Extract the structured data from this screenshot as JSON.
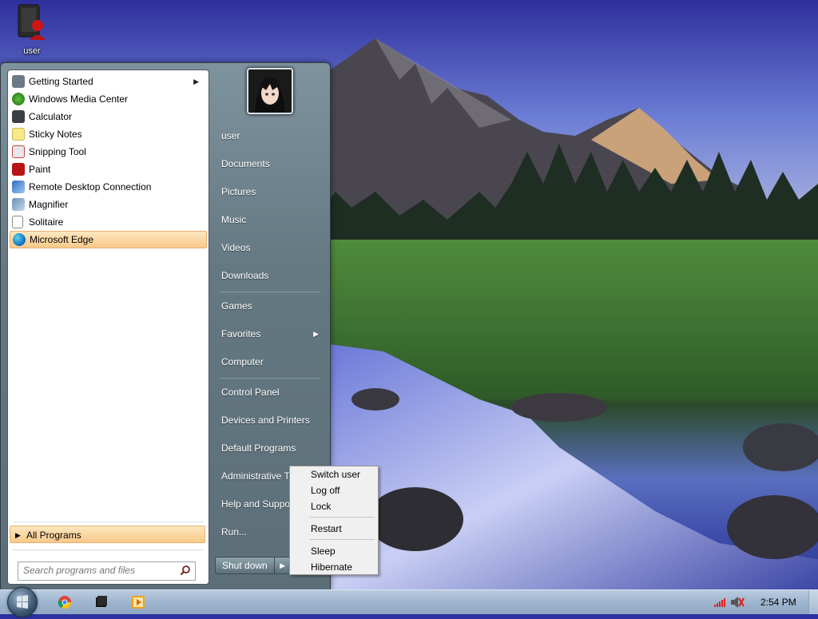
{
  "desktop": {
    "icons": [
      {
        "label": "user",
        "icon": "user-account-icon"
      }
    ]
  },
  "start_menu": {
    "pinned_programs": [
      {
        "label": "Getting Started",
        "icon": "getting-started-icon",
        "has_submenu": true
      },
      {
        "label": "Windows Media Center",
        "icon": "media-center-icon"
      },
      {
        "label": "Calculator",
        "icon": "calculator-icon"
      },
      {
        "label": "Sticky Notes",
        "icon": "sticky-notes-icon"
      },
      {
        "label": "Snipping Tool",
        "icon": "snipping-tool-icon"
      },
      {
        "label": "Paint",
        "icon": "paint-icon"
      },
      {
        "label": "Remote Desktop Connection",
        "icon": "remote-desktop-icon"
      },
      {
        "label": "Magnifier",
        "icon": "magnifier-icon"
      },
      {
        "label": "Solitaire",
        "icon": "solitaire-icon"
      },
      {
        "label": "Microsoft Edge",
        "icon": "edge-icon",
        "highlighted": true
      }
    ],
    "all_programs_label": "All Programs",
    "search_placeholder": "Search programs and files",
    "right_items": [
      {
        "label": "user"
      },
      {
        "label": "Documents"
      },
      {
        "label": "Pictures"
      },
      {
        "label": "Music"
      },
      {
        "label": "Videos"
      },
      {
        "label": "Downloads"
      },
      {
        "label": "Games"
      },
      {
        "label": "Favorites",
        "has_submenu": true
      },
      {
        "label": "Computer"
      },
      {
        "label": "Control Panel"
      },
      {
        "label": "Devices and Printers"
      },
      {
        "label": "Default Programs"
      },
      {
        "label": "Administrative T"
      },
      {
        "label": "Help and Suppo"
      },
      {
        "label": "Run..."
      }
    ],
    "shutdown_label": "Shut down"
  },
  "power_menu": {
    "items": [
      "Switch user",
      "Log off",
      "Lock",
      "Restart",
      "Sleep",
      "Hibernate"
    ]
  },
  "taskbar": {
    "pinned": [
      "chrome-icon",
      "terminal-icon",
      "media-player-icon"
    ],
    "clock": "2:54 PM"
  },
  "colors": {
    "highlight": "#f9c98a",
    "start_menu_bg": "#647882",
    "taskbar_bg": "#9fb6cf"
  }
}
